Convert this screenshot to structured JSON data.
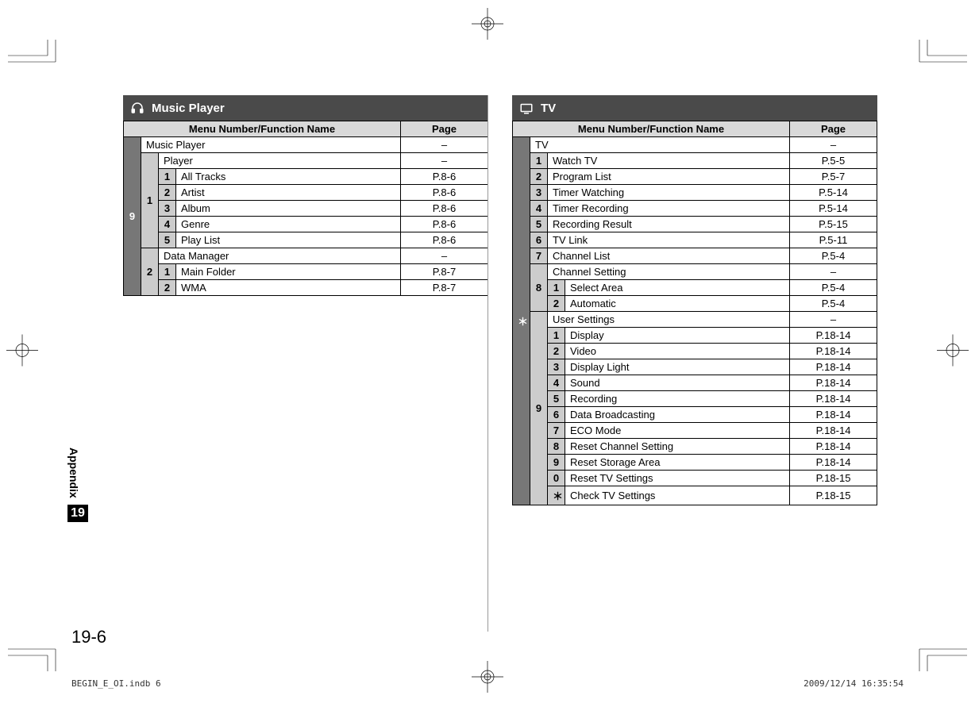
{
  "sidebar": {
    "label": "Appendix",
    "chapter": "19"
  },
  "page_number": "19-6",
  "footer": {
    "left": "BEGIN_E_OI.indb   6",
    "right": "2009/12/14   16:35:54"
  },
  "left": {
    "title": "Music Player",
    "header_menu": "Menu Number/Function Name",
    "header_page": "Page",
    "rows": [
      {
        "depth": 1,
        "num": "9",
        "name": "Music Player",
        "page": "–"
      },
      {
        "depth": 2,
        "num": "1",
        "name": "Player",
        "page": "–"
      },
      {
        "depth": 3,
        "num": "1",
        "name": "All Tracks",
        "page": "P.8-6"
      },
      {
        "depth": 3,
        "num": "2",
        "name": "Artist",
        "page": "P.8-6"
      },
      {
        "depth": 3,
        "num": "3",
        "name": "Album",
        "page": "P.8-6"
      },
      {
        "depth": 3,
        "num": "4",
        "name": "Genre",
        "page": "P.8-6"
      },
      {
        "depth": 3,
        "num": "5",
        "name": "Play List",
        "page": "P.8-6"
      },
      {
        "depth": 2,
        "num": "2",
        "name": "Data Manager",
        "page": "–"
      },
      {
        "depth": 3,
        "num": "1",
        "name": "Main Folder",
        "page": "P.8-7"
      },
      {
        "depth": 3,
        "num": "2",
        "name": "WMA",
        "page": "P.8-7"
      }
    ]
  },
  "right": {
    "title": "TV",
    "header_menu": "Menu Number/Function Name",
    "header_page": "Page",
    "rows": [
      {
        "depth": 1,
        "num": "＊",
        "name": "TV",
        "page": "–"
      },
      {
        "depth": 2,
        "num": "1",
        "name": "Watch TV",
        "page": "P.5-5"
      },
      {
        "depth": 2,
        "num": "2",
        "name": "Program List",
        "page": "P.5-7"
      },
      {
        "depth": 2,
        "num": "3",
        "name": "Timer Watching",
        "page": "P.5-14"
      },
      {
        "depth": 2,
        "num": "4",
        "name": "Timer Recording",
        "page": "P.5-14"
      },
      {
        "depth": 2,
        "num": "5",
        "name": "Recording Result",
        "page": "P.5-15"
      },
      {
        "depth": 2,
        "num": "6",
        "name": "TV Link",
        "page": "P.5-11"
      },
      {
        "depth": 2,
        "num": "7",
        "name": "Channel List",
        "page": "P.5-4"
      },
      {
        "depth": 2,
        "num": "8",
        "name": "Channel Setting",
        "page": "–"
      },
      {
        "depth": 3,
        "num": "1",
        "name": "Select Area",
        "page": "P.5-4"
      },
      {
        "depth": 3,
        "num": "2",
        "name": "Automatic",
        "page": "P.5-4"
      },
      {
        "depth": 2,
        "num": "9",
        "name": "User Settings",
        "page": "–"
      },
      {
        "depth": 3,
        "num": "1",
        "name": "Display",
        "page": "P.18-14"
      },
      {
        "depth": 3,
        "num": "2",
        "name": "Video",
        "page": "P.18-14"
      },
      {
        "depth": 3,
        "num": "3",
        "name": "Display Light",
        "page": "P.18-14"
      },
      {
        "depth": 3,
        "num": "4",
        "name": "Sound",
        "page": "P.18-14"
      },
      {
        "depth": 3,
        "num": "5",
        "name": "Recording",
        "page": "P.18-14"
      },
      {
        "depth": 3,
        "num": "6",
        "name": "Data Broadcasting",
        "page": "P.18-14"
      },
      {
        "depth": 3,
        "num": "7",
        "name": "ECO Mode",
        "page": "P.18-14"
      },
      {
        "depth": 3,
        "num": "8",
        "name": "Reset Channel Setting",
        "page": "P.18-14"
      },
      {
        "depth": 3,
        "num": "9",
        "name": "Reset Storage Area",
        "page": "P.18-14"
      },
      {
        "depth": 3,
        "num": "0",
        "name": "Reset TV Settings",
        "page": "P.18-15"
      },
      {
        "depth": 3,
        "num": "＊",
        "name": "Check TV Settings",
        "page": "P.18-15"
      }
    ]
  }
}
